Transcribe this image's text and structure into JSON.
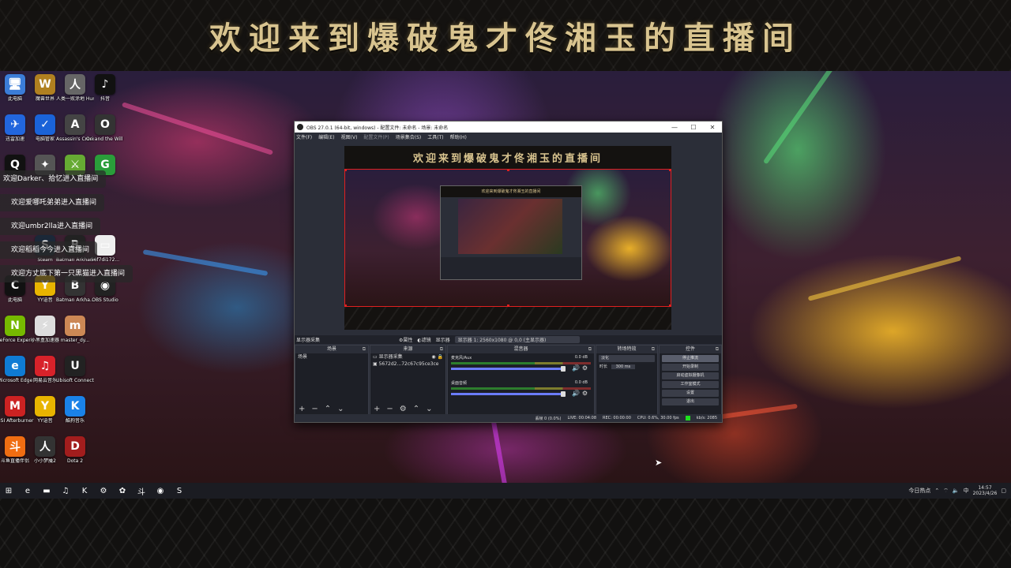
{
  "banner": {
    "title": "欢迎来到爆破鬼才佟湘玉的直播间"
  },
  "desktop_icons": [
    {
      "label": "此电脑",
      "glyph": "🖥",
      "color": "#3b7dd8"
    },
    {
      "label": "魔兽世界",
      "glyph": "W",
      "color": "#b08020"
    },
    {
      "label": "人类一败涂地 Hum...",
      "glyph": "人",
      "color": "#666"
    },
    {
      "label": "抖音",
      "glyph": "♪",
      "color": "#111"
    },
    {
      "label": "迅雷加速",
      "glyph": "✈",
      "color": "#2266dd"
    },
    {
      "label": "电脑管家",
      "glyph": "✓",
      "color": "#1a63d8"
    },
    {
      "label": "Assassin's Creed O...",
      "glyph": "A",
      "color": "#444"
    },
    {
      "label": "Ori and the Will of th...",
      "glyph": "O",
      "color": "#333"
    },
    {
      "label": "QQ",
      "glyph": "Q",
      "color": "#111"
    },
    {
      "label": "",
      "glyph": "✦",
      "color": "#555"
    },
    {
      "label": "",
      "glyph": "⚔",
      "color": "#6a3"
    },
    {
      "label": "",
      "glyph": "G",
      "color": "#2a9d3a"
    },
    {
      "label": "Steam",
      "glyph": "S",
      "color": "#1b2838"
    },
    {
      "label": "Batman Arkham...",
      "glyph": "B",
      "color": "#222"
    },
    {
      "label": "56f7di172...",
      "glyph": "▭",
      "color": "#eee"
    },
    {
      "label": "此电脑",
      "glyph": "C",
      "color": "#111"
    },
    {
      "label": "YY语音",
      "glyph": "Y",
      "color": "#e8b400"
    },
    {
      "label": "Batman Arkha...",
      "glyph": "B",
      "color": "#333"
    },
    {
      "label": "OBS Studio",
      "glyph": "◉",
      "color": "#222"
    },
    {
      "label": "GeForce Experience",
      "glyph": "N",
      "color": "#76b900"
    },
    {
      "label": "小黑盒加速器",
      "glyph": "⚡",
      "color": "#ddd"
    },
    {
      "label": "master_dy...",
      "glyph": "m",
      "color": "#c85"
    },
    {
      "label": "Microsoft Edge",
      "glyph": "e",
      "color": "#0f7bd4"
    },
    {
      "label": "网易云音乐",
      "glyph": "♫",
      "color": "#d8222a"
    },
    {
      "label": "Ubisoft Connect",
      "glyph": "U",
      "color": "#222"
    },
    {
      "label": "MSI Afterburner",
      "glyph": "M",
      "color": "#c22"
    },
    {
      "label": "YY语音",
      "glyph": "Y",
      "color": "#e8b400"
    },
    {
      "label": "酷狗音乐",
      "glyph": "K",
      "color": "#1a82e8"
    },
    {
      "label": "斗鱼直播伴侣",
      "glyph": "斗",
      "color": "#f06d12"
    },
    {
      "label": "小小梦魇2",
      "glyph": "人",
      "color": "#333"
    },
    {
      "label": "Dota 2",
      "glyph": "D",
      "color": "#a21d1d"
    }
  ],
  "welcome_messages": [
    "欢迎Darker、拾忆进入直播间",
    "欢迎爱哪吒弟弟进入直播间",
    "欢迎umbr2lla进入直播间",
    "欢迎稻稻今今进入直播间",
    "欢迎方丈底下第一只黑猫进入直播间"
  ],
  "obs": {
    "title": "OBS 27.0.1 (64-bit, windows) - 配置文件: 未命名 - 场景: 未命名",
    "menu": [
      "文件(F)",
      "编辑(E)",
      "视图(V)",
      "配置文件(P)",
      "场景集合(S)",
      "工具(T)",
      "帮助(H)"
    ],
    "preview_banner": "欢迎来到爆破鬼才佟湘玉的直播间",
    "preview_inner_banner": "欢迎来到爆破鬼才佟湘玉的直播间",
    "source_bar": {
      "source_name": "显示器采集",
      "properties": "⚙属性",
      "filters": "◐滤镜",
      "display_label": "显示器",
      "display_value": "显示器 1: 2560x1080 @ 0,0 (主显示器)"
    },
    "docks": {
      "scenes": {
        "title": "场景",
        "items": [
          "场景"
        ]
      },
      "sources": {
        "title": "来源",
        "items": [
          "显示器采集",
          "5672d2...72c67c95ce3ce"
        ]
      },
      "mixer": {
        "title": "混音器",
        "tracks": [
          {
            "name": "麦克风/Aux",
            "db": "0.0 dB"
          },
          {
            "name": "桌面音频",
            "db": "0.0 dB"
          }
        ]
      },
      "transitions": {
        "title": "转场特效",
        "type": "淡化",
        "duration_label": "时长",
        "duration": "300 ms"
      },
      "controls": {
        "title": "控件",
        "buttons": [
          "停止推流",
          "开始录制",
          "启动虚拟摄像机",
          "工作室模式",
          "设置",
          "退出"
        ]
      }
    },
    "status": {
      "dropped": "丢帧 0 (0.0%)",
      "live": "LIVE: 00:04:08",
      "rec": "REC: 00:00:00",
      "cpu": "CPU: 0.6%, 30.00 fps",
      "kbps": "kb/s: 2085"
    }
  },
  "taskbar": {
    "icons": [
      {
        "name": "start-icon",
        "glyph": "⊞"
      },
      {
        "name": "edge-icon",
        "glyph": "e"
      },
      {
        "name": "file-explorer-icon",
        "glyph": "▬"
      },
      {
        "name": "netease-icon",
        "glyph": "♫"
      },
      {
        "name": "kugou-icon",
        "glyph": "K"
      },
      {
        "name": "settings-icon",
        "glyph": "⚙"
      },
      {
        "name": "color-app-icon",
        "glyph": "✿"
      },
      {
        "name": "douyu-icon",
        "glyph": "斗"
      },
      {
        "name": "obs-icon",
        "glyph": "◉"
      },
      {
        "name": "steam-icon",
        "glyph": "S"
      }
    ],
    "news": "今日热点",
    "ime": "中",
    "time": "14:57",
    "date": "2023/4/26"
  }
}
